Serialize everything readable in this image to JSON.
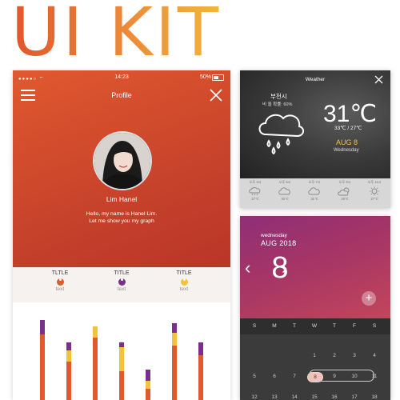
{
  "title": "UI KIT",
  "profile": {
    "status": {
      "time": "14:23",
      "battery": "50%"
    },
    "header_title": "Profile",
    "name": "Lim Hanel",
    "bio_line1": "Hello, my name is Hanel Lim.",
    "bio_line2": "Let me show you my graph",
    "tabs": [
      {
        "label": "TLTLE",
        "text": "text",
        "color": "#e0592f"
      },
      {
        "label": "TITLE",
        "text": "text",
        "color": "#7a2e8e"
      },
      {
        "label": "TITLE",
        "text": "text",
        "color": "#f2c23a"
      }
    ],
    "graph_bars": [
      {
        "total": 100,
        "purple": 18,
        "yellow": 0
      },
      {
        "total": 72,
        "purple": 10,
        "yellow": 14
      },
      {
        "total": 92,
        "purple": 0,
        "yellow": 14
      },
      {
        "total": 72,
        "purple": 6,
        "yellow": 30
      },
      {
        "total": 38,
        "purple": 14,
        "yellow": 10
      },
      {
        "total": 96,
        "purple": 12,
        "yellow": 16
      },
      {
        "total": 72,
        "purple": 16,
        "yellow": 0
      }
    ],
    "colors": {
      "orange": "#e0592f",
      "purple": "#7a2e8e",
      "yellow": "#f2c23a"
    }
  },
  "weather": {
    "header": "Weather",
    "city": "부천시",
    "rain": "비 올 확률: 60%",
    "temp": "31℃",
    "range": "33℃ / 27℃",
    "date": "AUG 8",
    "day": "Wednesday",
    "forecast": [
      {
        "label": "오후 3시",
        "temp": "27℃",
        "icon": "rain-cloud-icon"
      },
      {
        "label": "오후 5시",
        "temp": "30℃",
        "icon": "cloud-icon"
      },
      {
        "label": "오후 7시",
        "temp": "31℃",
        "icon": "cloud-icon"
      },
      {
        "label": "오후 9시",
        "temp": "29℃",
        "icon": "sun-cloud-icon"
      },
      {
        "label": "오후 11시",
        "temp": "27℃",
        "icon": "sun-icon"
      }
    ]
  },
  "calendar": {
    "weekday": "wednesday",
    "month": "AUG 2018",
    "day": "8",
    "weekdays": [
      "S",
      "M",
      "T",
      "W",
      "T",
      "F",
      "S"
    ],
    "rows": [
      [
        "",
        "",
        "",
        "1",
        "2",
        "3",
        "4"
      ],
      [
        "5",
        "6",
        "7",
        "8",
        "9",
        "10",
        "11"
      ],
      [
        "12",
        "13",
        "14",
        "15",
        "16",
        "17",
        "18"
      ]
    ],
    "selected": "8"
  }
}
